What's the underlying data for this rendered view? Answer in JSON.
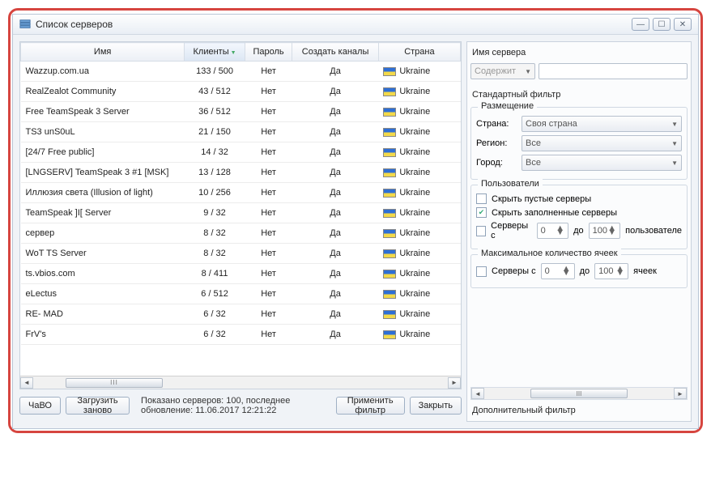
{
  "window": {
    "title": "Список серверов"
  },
  "table": {
    "headers": {
      "name": "Имя",
      "clients": "Клиенты",
      "password": "Пароль",
      "channels": "Создать каналы",
      "country": "Страна"
    },
    "rows": [
      {
        "name": "Wazzup.com.ua",
        "clients": "133 / 500",
        "password": "Нет",
        "channels": "Да",
        "country": "Ukraine"
      },
      {
        "name": "RealZealot Community",
        "clients": "43 / 512",
        "password": "Нет",
        "channels": "Да",
        "country": "Ukraine"
      },
      {
        "name": "Free TeamSpeak 3 Server",
        "clients": "36 / 512",
        "password": "Нет",
        "channels": "Да",
        "country": "Ukraine"
      },
      {
        "name": "TS3 unS0uL",
        "clients": "21 / 150",
        "password": "Нет",
        "channels": "Да",
        "country": "Ukraine"
      },
      {
        "name": "[24/7 Free public]",
        "clients": "14 / 32",
        "password": "Нет",
        "channels": "Да",
        "country": "Ukraine"
      },
      {
        "name": "[LNGSERV] TeamSpeak 3 #1 [MSK]",
        "clients": "13 / 128",
        "password": "Нет",
        "channels": "Да",
        "country": "Ukraine"
      },
      {
        "name": "Иллюзия света (Illusion of light)",
        "clients": "10 / 256",
        "password": "Нет",
        "channels": "Да",
        "country": "Ukraine"
      },
      {
        "name": "TeamSpeak ]I[ Server",
        "clients": "9 / 32",
        "password": "Нет",
        "channels": "Да",
        "country": "Ukraine"
      },
      {
        "name": "сервер",
        "clients": "8 / 32",
        "password": "Нет",
        "channels": "Да",
        "country": "Ukraine"
      },
      {
        "name": "WoT TS Server",
        "clients": "8 / 32",
        "password": "Нет",
        "channels": "Да",
        "country": "Ukraine"
      },
      {
        "name": "ts.vbios.com",
        "clients": "8 / 411",
        "password": "Нет",
        "channels": "Да",
        "country": "Ukraine"
      },
      {
        "name": "eLectus",
        "clients": "6 / 512",
        "password": "Нет",
        "channels": "Да",
        "country": "Ukraine"
      },
      {
        "name": "RE- MAD",
        "clients": "6 / 32",
        "password": "Нет",
        "channels": "Да",
        "country": "Ukraine"
      },
      {
        "name": "FrV's",
        "clients": "6 / 32",
        "password": "Нет",
        "channels": "Да",
        "country": "Ukraine"
      }
    ]
  },
  "bottom": {
    "faq": "ЧаВО",
    "reload": "Загрузить заново",
    "status": "Показано серверов: 100, последнее обновление: 11.06.2017 12:21:22",
    "apply": "Применить фильтр",
    "close": "Закрыть"
  },
  "filter": {
    "serverName": "Имя сервера",
    "contains": "Содержит",
    "standard": "Стандартный фильтр",
    "location": "Размещение",
    "countryLabel": "Страна:",
    "countryValue": "Своя страна",
    "regionLabel": "Регион:",
    "regionValue": "Все",
    "cityLabel": "Город:",
    "cityValue": "Все",
    "users": "Пользователи",
    "hideEmpty": "Скрыть пустые серверы",
    "hideFull": "Скрыть заполненные серверы",
    "serversWith": "Серверы с",
    "to": "до",
    "usersWord": "пользователе",
    "maxSlots": "Максимальное количество ячеек",
    "slotsWord": "ячеек",
    "min": "0",
    "max": "100",
    "additional": "Дополнительный фильтр"
  }
}
